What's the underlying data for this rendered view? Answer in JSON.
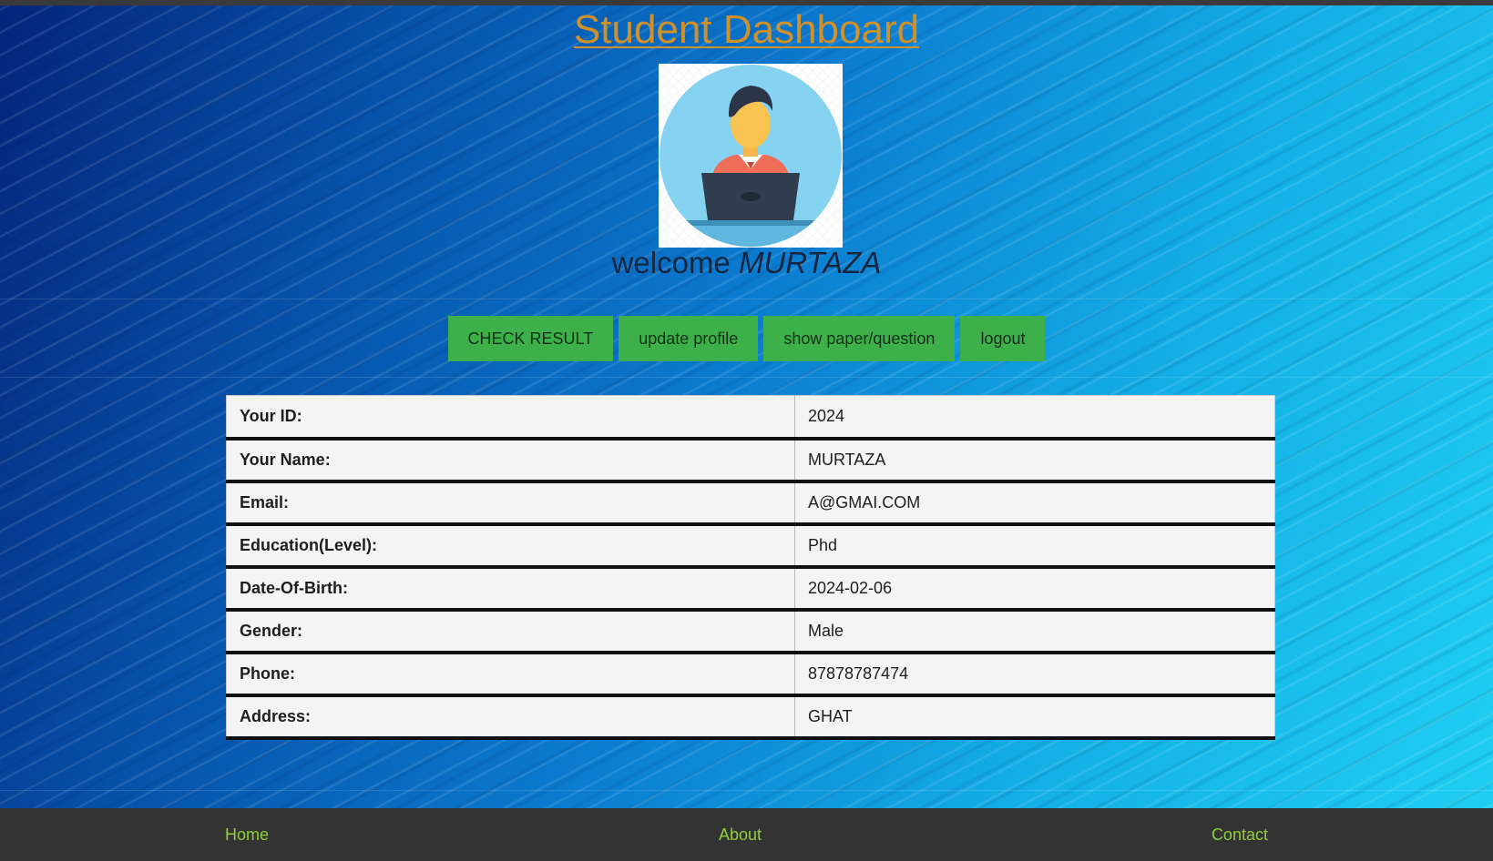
{
  "page": {
    "title": "Student Dashboard",
    "welcome_prefix": "welcome",
    "welcome_name": "MURTAZA"
  },
  "avatar": {
    "icon": "student-at-laptop-icon"
  },
  "actions": [
    {
      "label": "CHECK RESULT"
    },
    {
      "label": "update profile"
    },
    {
      "label": "show paper/question"
    },
    {
      "label": "logout"
    }
  ],
  "profile": {
    "rows": [
      {
        "label": "Your ID:",
        "value": "2024"
      },
      {
        "label": "Your Name:",
        "value": "MURTAZA"
      },
      {
        "label": "Email:",
        "value": "A@GMAI.COM"
      },
      {
        "label": "Education(Level):",
        "value": "Phd"
      },
      {
        "label": "Date-Of-Birth:",
        "value": "2024-02-06"
      },
      {
        "label": "Gender:",
        "value": "Male"
      },
      {
        "label": "Phone:",
        "value": "87878787474"
      },
      {
        "label": "Address:",
        "value": "GHAT"
      }
    ]
  },
  "footer": {
    "links": [
      {
        "label": "Home"
      },
      {
        "label": "About"
      },
      {
        "label": "Contact"
      }
    ]
  },
  "colors": {
    "title": "#d1912a",
    "button": "#3eb049",
    "footer_bg": "#333333",
    "footer_link": "#8fd03a"
  }
}
